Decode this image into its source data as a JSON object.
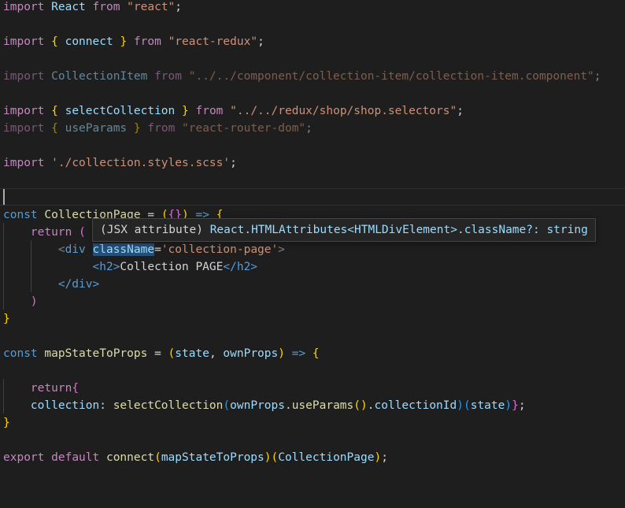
{
  "editor": {
    "language": "javascript-react",
    "lines": {
      "l1": {
        "kw_import": "import",
        "name": "React",
        "kw_from": "from",
        "source": "\"react\"",
        "semi": ";"
      },
      "l3": {
        "kw_import": "import",
        "brace_open": "{",
        "name": "connect",
        "brace_close": "}",
        "kw_from": "from",
        "source": "\"react-redux\"",
        "semi": ";"
      },
      "l5": {
        "kw_import": "import",
        "name": "CollectionItem",
        "kw_from": "from",
        "source": "\"../../component/collection-item/collection-item.component\"",
        "semi": ";"
      },
      "l7": {
        "kw_import": "import",
        "brace_open": "{",
        "name": "selectCollection",
        "brace_close": "}",
        "kw_from": "from",
        "source": "\"../../redux/shop/shop.selectors\"",
        "semi": ";"
      },
      "l8": {
        "kw_import": "import",
        "brace_open": "{",
        "name": "useParams",
        "brace_close": "}",
        "kw_from": "from",
        "source": "\"react-router-dom\"",
        "semi": ";"
      },
      "l10": {
        "kw_import": "import",
        "source": "'./collection.styles.scss'",
        "semi": ";"
      },
      "l12": {
        "kw_const": "const",
        "name": "CollectionPage",
        "eq": "=",
        "paren_open": "(",
        "brace_open": "{",
        "brace_close": "}",
        "paren_close": ")",
        "arrow": "=>",
        "body_open": "{"
      },
      "l13": {
        "kw_return": "return",
        "paren": "("
      },
      "l14": {
        "lt": "<",
        "tag": "div",
        "attr": "className",
        "eq": "=",
        "value": "'collection-page'",
        "gt": ">"
      },
      "l15": {
        "open": "<h2>",
        "text": "Collection PAGE",
        "close": "</h2>"
      },
      "l16": {
        "close": "</div>"
      },
      "l17": {
        "paren": ")"
      },
      "l18": {
        "brace": "}"
      },
      "l20": {
        "kw_const": "const",
        "name": "mapStateToProps",
        "eq": "=",
        "paren_open": "(",
        "p1": "state",
        "comma": ",",
        "p2": "ownProps",
        "paren_close": ")",
        "arrow": "=>",
        "body_open": "{"
      },
      "l22": {
        "kw_return": "return",
        "brace": "{"
      },
      "l23": {
        "key": "collection",
        "colon": ":",
        "fn": "selectCollection",
        "p_open1": "(",
        "obj": "ownProps",
        "dot1": ".",
        "method": "useParams",
        "call": "()",
        "dot2": ".",
        "prop": "collectionId",
        "p_close1": ")",
        "p_open2": "(",
        "arg": "state",
        "p_close2": ")",
        "brace": "}",
        "semi": ";"
      },
      "l24": {
        "brace": "}"
      },
      "l26": {
        "kw_export": "export",
        "kw_default": "default",
        "fn": "connect",
        "p_open1": "(",
        "arg1": "mapStateToProps",
        "p_close1": ")",
        "p_open2": "(",
        "arg2": "CollectionPage",
        "p_close2": ")",
        "semi": ";"
      }
    }
  },
  "hover_tooltip": {
    "kind": "(JSX attribute)",
    "signature": "React.HTMLAttributes<HTMLDivElement>.className?: string"
  },
  "theme": {
    "background": "#1e1e1e",
    "keyword": "#569cd6",
    "control_keyword": "#c586c0",
    "function": "#dcdcaa",
    "variable": "#9cdcfe",
    "string": "#ce9178",
    "bracket_level1": "#ffd700",
    "bracket_level2": "#da70d6",
    "bracket_level3": "#179fff"
  }
}
